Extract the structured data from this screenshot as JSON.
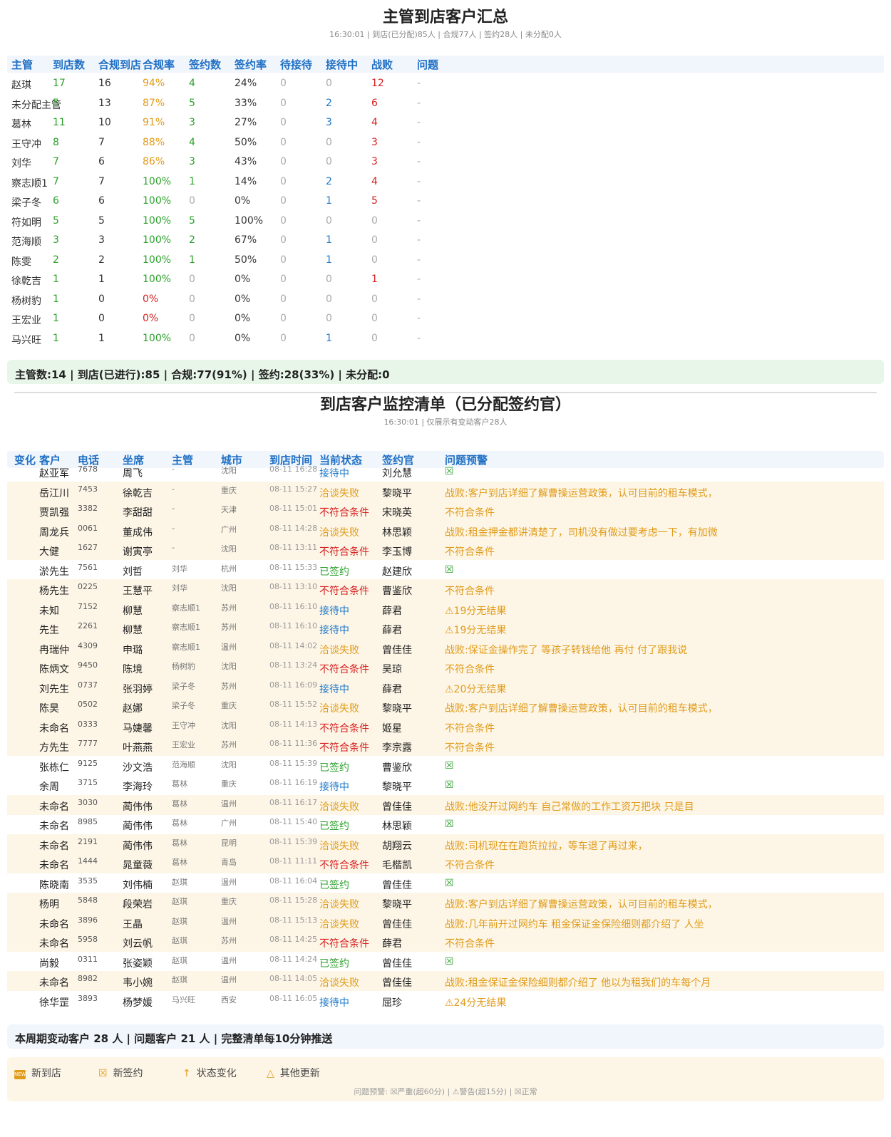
{
  "report1": {
    "title": "主管到店客户汇总",
    "subtitle": "16:30:01 | 到店(已分配)85人 | 合规77人 | 签约28人 | 未分配0人",
    "headers": [
      "主管",
      "到店数",
      "合规到店",
      "合规率",
      "签约数",
      "签约率",
      "待接待",
      "接待中",
      "战败",
      "问题"
    ],
    "rows": [
      [
        "赵琪",
        "17",
        "16",
        "94%",
        "4",
        "24%",
        "0",
        "0",
        "12",
        "-"
      ],
      [
        "未分配主管",
        "5",
        "13",
        "87%",
        "5",
        "33%",
        "0",
        "2",
        "6",
        "-"
      ],
      [
        "葛林",
        "11",
        "10",
        "91%",
        "3",
        "27%",
        "0",
        "3",
        "4",
        "-"
      ],
      [
        "王守冲",
        "8",
        "7",
        "88%",
        "4",
        "50%",
        "0",
        "0",
        "3",
        "-"
      ],
      [
        "刘华",
        "7",
        "6",
        "86%",
        "3",
        "43%",
        "0",
        "0",
        "3",
        "-"
      ],
      [
        "察志顺1",
        "7",
        "7",
        "100%",
        "1",
        "14%",
        "0",
        "2",
        "4",
        "-"
      ],
      [
        "梁子冬",
        "6",
        "6",
        "100%",
        "0",
        "0%",
        "0",
        "1",
        "5",
        "-"
      ],
      [
        "符如明",
        "5",
        "5",
        "100%",
        "5",
        "100%",
        "0",
        "0",
        "0",
        "-"
      ],
      [
        "范海顺",
        "3",
        "3",
        "100%",
        "2",
        "67%",
        "0",
        "1",
        "0",
        "-"
      ],
      [
        "陈雯",
        "2",
        "2",
        "100%",
        "1",
        "50%",
        "0",
        "1",
        "0",
        "-"
      ],
      [
        "徐乾吉",
        "1",
        "1",
        "100%",
        "0",
        "0%",
        "0",
        "0",
        "1",
        "-"
      ],
      [
        "杨树豹",
        "1",
        "0",
        "0%",
        "0",
        "0%",
        "0",
        "0",
        "0",
        "-"
      ],
      [
        "王宏业",
        "1",
        "0",
        "0%",
        "0",
        "0%",
        "0",
        "0",
        "0",
        "-"
      ],
      [
        "马兴旺",
        "1",
        "1",
        "100%",
        "0",
        "0%",
        "0",
        "1",
        "0",
        "-"
      ]
    ],
    "summary": "主管数:14 | 到店(已进行):85 | 合规:77(91%) | 签约:28(33%) | 未分配:0"
  },
  "report2": {
    "title": "到店客户监控清单（已分配签约官）",
    "subtitle": "16:30:01 | 仅展示有变动客户28人",
    "headers": [
      "变化",
      "客户",
      "电话",
      "坐席",
      "主管",
      "城市",
      "到店时间",
      "当前状态",
      "签约官",
      "问题预警"
    ],
    "rows": [
      {
        "cust": "赵亚军",
        "phone": "7678",
        "agent": "周飞",
        "mgr": "-",
        "city": "沈阳",
        "time": "08-11 16:28",
        "status": "接待中",
        "officer": "刘允慧",
        "alert": "☒",
        "warn": false
      },
      {
        "cust": "岳江川",
        "phone": "7453",
        "agent": "徐乾吉",
        "mgr": "-",
        "city": "重庆",
        "time": "08-11 15:27",
        "status": "洽谈失败",
        "officer": "黎晓平",
        "alert": "战败:客户到店详细了解曹操运营政策，认可目前的租车模式，",
        "warn": true
      },
      {
        "cust": "贾凯强",
        "phone": "3382",
        "agent": "李甜甜",
        "mgr": "-",
        "city": "天津",
        "time": "08-11 15:01",
        "status": "不符合条件",
        "officer": "宋晓英",
        "alert": "不符合条件",
        "warn": true
      },
      {
        "cust": "周龙兵",
        "phone": "0061",
        "agent": "董成伟",
        "mgr": "-",
        "city": "广州",
        "time": "08-11 14:28",
        "status": "洽谈失败",
        "officer": "林思颖",
        "alert": "战败:租金押金都讲清楚了，司机没有做过要考虑一下，有加微",
        "warn": true
      },
      {
        "cust": "大健",
        "phone": "1627",
        "agent": "谢寅亭",
        "mgr": "-",
        "city": "沈阳",
        "time": "08-11 13:11",
        "status": "不符合条件",
        "officer": "李玉博",
        "alert": "不符合条件",
        "warn": true
      },
      {
        "cust": "淤先生",
        "phone": "7561",
        "agent": "刘哲",
        "mgr": "刘华",
        "city": "杭州",
        "time": "08-11 15:33",
        "status": "已签约",
        "officer": "赵建欣",
        "alert": "☒",
        "warn": false
      },
      {
        "cust": "杨先生",
        "phone": "0225",
        "agent": "王慧平",
        "mgr": "刘华",
        "city": "沈阳",
        "time": "08-11 13:10",
        "status": "不符合条件",
        "officer": "曹鉴欣",
        "alert": "不符合条件",
        "warn": true
      },
      {
        "cust": "未知",
        "phone": "7152",
        "agent": "柳慧",
        "mgr": "察志顺1",
        "city": "苏州",
        "time": "08-11 16:10",
        "status": "接待中",
        "officer": "薛君",
        "alert": "⚠19分无结果",
        "warn": true
      },
      {
        "cust": "先生",
        "phone": "2261",
        "agent": "柳慧",
        "mgr": "察志顺1",
        "city": "苏州",
        "time": "08-11 16:10",
        "status": "接待中",
        "officer": "薛君",
        "alert": "⚠19分无结果",
        "warn": true
      },
      {
        "cust": "冉瑞仲",
        "phone": "4309",
        "agent": "申璐",
        "mgr": "察志顺1",
        "city": "温州",
        "time": "08-11 14:02",
        "status": "洽谈失败",
        "officer": "曾佳佳",
        "alert": "战败:保证金操作完了 等孩子转钱给他 再付 付了跟我说",
        "warn": true
      },
      {
        "cust": "陈炳文",
        "phone": "9450",
        "agent": "陈境",
        "mgr": "杨树豹",
        "city": "沈阳",
        "time": "08-11 13:24",
        "status": "不符合条件",
        "officer": "吴琼",
        "alert": "不符合条件",
        "warn": true
      },
      {
        "cust": "刘先生",
        "phone": "0737",
        "agent": "张羽婷",
        "mgr": "梁子冬",
        "city": "苏州",
        "time": "08-11 16:09",
        "status": "接待中",
        "officer": "薛君",
        "alert": "⚠20分无结果",
        "warn": true
      },
      {
        "cust": "陈昊",
        "phone": "0502",
        "agent": "赵娜",
        "mgr": "梁子冬",
        "city": "重庆",
        "time": "08-11 15:52",
        "status": "洽谈失败",
        "officer": "黎晓平",
        "alert": "战败:客户到店详细了解曹操运营政策，认可目前的租车模式，",
        "warn": true
      },
      {
        "cust": "未命名",
        "phone": "0333",
        "agent": "马婕馨",
        "mgr": "王守冲",
        "city": "沈阳",
        "time": "08-11 14:13",
        "status": "不符合条件",
        "officer": "姬星",
        "alert": "不符合条件",
        "warn": true
      },
      {
        "cust": "方先生",
        "phone": "7777",
        "agent": "叶燕燕",
        "mgr": "王宏业",
        "city": "苏州",
        "time": "08-11 11:36",
        "status": "不符合条件",
        "officer": "李宗露",
        "alert": "不符合条件",
        "warn": true
      },
      {
        "cust": "张栋仁",
        "phone": "9125",
        "agent": "沙文浩",
        "mgr": "范海顺",
        "city": "沈阳",
        "time": "08-11 15:39",
        "status": "已签约",
        "officer": "曹鉴欣",
        "alert": "☒",
        "warn": false
      },
      {
        "cust": "余周",
        "phone": "3715",
        "agent": "李海玲",
        "mgr": "葛林",
        "city": "重庆",
        "time": "08-11 16:19",
        "status": "接待中",
        "officer": "黎晓平",
        "alert": "☒",
        "warn": false
      },
      {
        "cust": "未命名",
        "phone": "3030",
        "agent": "蔺伟伟",
        "mgr": "葛林",
        "city": "温州",
        "time": "08-11 16:17",
        "status": "洽谈失败",
        "officer": "曾佳佳",
        "alert": "战败:他没开过网约车 自己常做的工作工资万把块 只是目",
        "warn": true
      },
      {
        "cust": "未命名",
        "phone": "8985",
        "agent": "蔺伟伟",
        "mgr": "葛林",
        "city": "广州",
        "time": "08-11 15:40",
        "status": "已签约",
        "officer": "林思颖",
        "alert": "☒",
        "warn": false
      },
      {
        "cust": "未命名",
        "phone": "2191",
        "agent": "蔺伟伟",
        "mgr": "葛林",
        "city": "昆明",
        "time": "08-11 15:39",
        "status": "洽谈失败",
        "officer": "胡翔云",
        "alert": "战败:司机现在在跑货拉拉，等车退了再过来，",
        "warn": true
      },
      {
        "cust": "未命名",
        "phone": "1444",
        "agent": "晁童薇",
        "mgr": "葛林",
        "city": "青岛",
        "time": "08-11 11:11",
        "status": "不符合条件",
        "officer": "毛楷凯",
        "alert": "不符合条件",
        "warn": true
      },
      {
        "cust": "陈晓南",
        "phone": "3535",
        "agent": "刘伟楠",
        "mgr": "赵琪",
        "city": "温州",
        "time": "08-11 16:04",
        "status": "已签约",
        "officer": "曾佳佳",
        "alert": "☒",
        "warn": false
      },
      {
        "cust": "杨明",
        "phone": "5848",
        "agent": "段荣岩",
        "mgr": "赵琪",
        "city": "重庆",
        "time": "08-11 15:28",
        "status": "洽谈失败",
        "officer": "黎晓平",
        "alert": "战败:客户到店详细了解曹操运营政策，认可目前的租车模式，",
        "warn": true
      },
      {
        "cust": "未命名",
        "phone": "3896",
        "agent": "王晶",
        "mgr": "赵琪",
        "city": "温州",
        "time": "08-11 15:13",
        "status": "洽谈失败",
        "officer": "曾佳佳",
        "alert": "战败:几年前开过网约车 租金保证金保险细则都介绍了 人坐",
        "warn": true
      },
      {
        "cust": "未命名",
        "phone": "5958",
        "agent": "刘云帆",
        "mgr": "赵琪",
        "city": "苏州",
        "time": "08-11 14:25",
        "status": "不符合条件",
        "officer": "薛君",
        "alert": "不符合条件",
        "warn": true
      },
      {
        "cust": "尚毅",
        "phone": "0311",
        "agent": "张姿颖",
        "mgr": "赵琪",
        "city": "温州",
        "time": "08-11 14:24",
        "status": "已签约",
        "officer": "曾佳佳",
        "alert": "☒",
        "warn": false
      },
      {
        "cust": "未命名",
        "phone": "8982",
        "agent": "韦小婉",
        "mgr": "赵琪",
        "city": "温州",
        "time": "08-11 14:05",
        "status": "洽谈失败",
        "officer": "曾佳佳",
        "alert": "战败:租金保证金保险细则都介绍了 他以为租我们的车每个月",
        "warn": true
      },
      {
        "cust": "徐华罡",
        "phone": "3893",
        "agent": "杨梦媛",
        "mgr": "马兴旺",
        "city": "西安",
        "time": "08-11 16:05",
        "status": "接待中",
        "officer": "屈珍",
        "alert": "⚠24分无结果",
        "warn": false
      }
    ],
    "summary": "本周期变动客户 28 人 | 问题客户 21 人 | 完整清单每10分钟推送"
  },
  "legend": {
    "new_icon": "NEW",
    "new_label": "新到店",
    "sign_icon": "☒",
    "sign_label": "新签约",
    "change_icon": "↑",
    "change_label": "状态变化",
    "other_icon": "△",
    "other_label": "其他更新",
    "note": "问题预警: ☒严重(超60分) | ⚠警告(超15分) | ☒正常"
  },
  "colors": {
    "header_blue": "#1f6fc4",
    "green": "#2ca02c",
    "orange": "#e09b1a",
    "red": "#d62020",
    "blue": "#1f78c8",
    "warn_row_bg": "#fdf6e7",
    "summary_green_bg": "#e8f6e9"
  }
}
